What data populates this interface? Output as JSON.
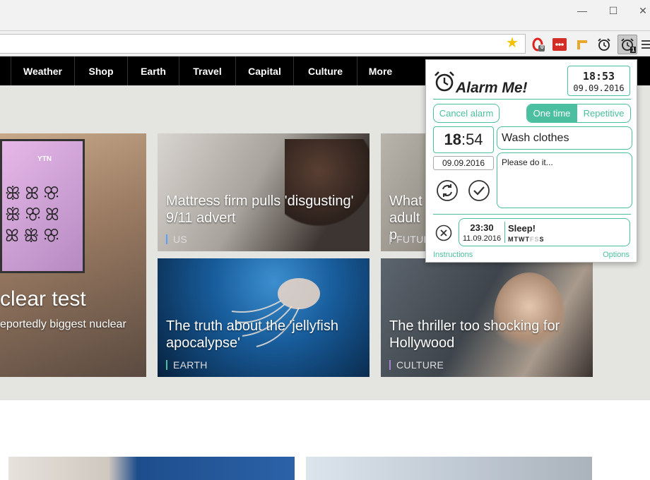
{
  "nav": {
    "items": [
      "Weather",
      "Shop",
      "Earth",
      "Travel",
      "Capital",
      "Culture",
      "More"
    ]
  },
  "extensions": {
    "opera_badge": "0",
    "alarm_badge": "1"
  },
  "cards": [
    {
      "title": "clear test",
      "subtitle": "eportedly biggest nuclear",
      "tag": ""
    },
    {
      "title": "Mattress firm pulls 'disgusting' 9/11 advert",
      "tag": "US"
    },
    {
      "title": "What adult p",
      "tag": "FUTUR"
    },
    {
      "title": "The truth about the 'jellyfish apocalypse'",
      "tag": "EARTH"
    },
    {
      "title": "The thriller too shocking for Hollywood",
      "tag": "CULTURE"
    }
  ],
  "popup": {
    "title": "Alarm Me!",
    "current_time": "18:53",
    "current_date": "09.09.2016",
    "cancel_label": "Cancel alarm",
    "tab_one_time": "One time",
    "tab_repetitive": "Repetitive",
    "set_hour": "18",
    "set_sep": ":",
    "set_minute": "54",
    "set_date": "09.09.2016",
    "title_value": "Wash clothes",
    "note_value": "Please do it...",
    "alarm_time": "23:30",
    "alarm_date": "11.09.2016",
    "alarm_name": "Sleep!",
    "alarm_days_active": "MTWT",
    "alarm_days_inactive": "FS",
    "alarm_days_sunday": "S",
    "instructions_label": "Instructions",
    "options_label": "Options"
  },
  "colors": {
    "accent": "#4bbf9f",
    "nav_bg": "#000000",
    "content_bg": "#e4e4e0"
  }
}
